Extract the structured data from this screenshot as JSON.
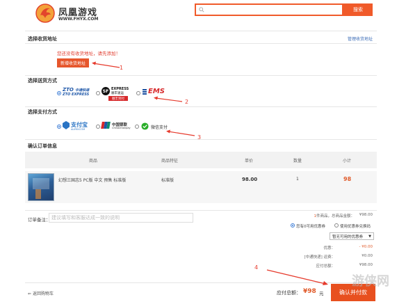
{
  "header": {
    "brand_cn": "凤凰游戏",
    "brand_url": "WWW.FHYX.COM",
    "search_placeholder": "",
    "search_button": "搜索"
  },
  "address": {
    "title": "选择收货地址",
    "manage_link": "管理收货地址",
    "warning": "您还没有收货地址，请先添加！",
    "add_button": "新增收货地址",
    "annotation": "1"
  },
  "shipping": {
    "title": "选择送货方式",
    "options": [
      {
        "label_cn": "中通快递",
        "label_en": "ZTO EXPRESS",
        "selected": true
      },
      {
        "label_cn": "顺丰速运",
        "label_en": "EXPRESS",
        "badge": "顺丰到付",
        "selected": false
      },
      {
        "label_cn": "",
        "label_en": "EMS",
        "selected": false
      }
    ],
    "annotation": "2"
  },
  "payment": {
    "title": "选择支付方式",
    "options": [
      {
        "label": "支付宝",
        "sub": "ALIPAY.COM",
        "selected": true
      },
      {
        "label": "中国银联",
        "sub": "ChinaUnionpay",
        "selected": false
      },
      {
        "label": "微信支付",
        "selected": false
      }
    ],
    "annotation": "3"
  },
  "order": {
    "title": "确认订单信息",
    "columns": [
      "商品",
      "商品特征",
      "单价",
      "数量",
      "小计"
    ],
    "rows": [
      {
        "name": "幻想三国志5 PC版 中文 预售 标准版",
        "feature": "标准版",
        "price": "98.00",
        "qty": "1",
        "subtotal": "98"
      }
    ]
  },
  "remark": {
    "label": "订单备注：",
    "placeholder": "建议填写和客服达成一致的说明"
  },
  "summary": {
    "count_prefix": "1",
    "count_text": "件商品，总商品金额：",
    "total_goods": "¥98.00",
    "coupon_radio_1": "您有0可用优惠券",
    "coupon_radio_2": "使用优惠券兑换码",
    "coupon_select": "暂无可用的优惠券",
    "discount_label": "优惠：",
    "discount_value": "- ¥0.00",
    "shipping_label": "[中通快递] 运费：",
    "shipping_value": "¥0.00",
    "payable_label": "应付总额：",
    "payable_value": "¥98.00"
  },
  "footer": {
    "back_link": "返回购物车",
    "total_label": "应付总额：",
    "total_value": "¥98",
    "total_unit": "元",
    "confirm_button": "确认并付款",
    "annotation": "4",
    "watermark": "游侠网"
  }
}
